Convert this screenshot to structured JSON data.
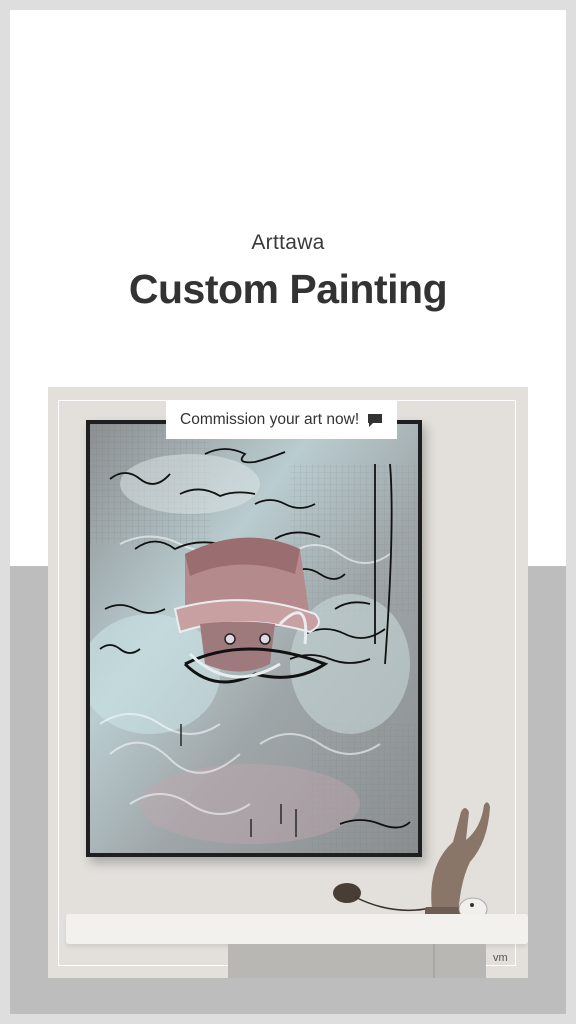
{
  "brand": "Arttawa",
  "title": "Custom Painting",
  "badge": {
    "label": "Commission your art now!",
    "icon": "chat-bubble-icon"
  },
  "watermark": "vm",
  "colors": {
    "background_top": "#ffffff",
    "background_bottom": "#bdbdbd",
    "border": "#dedede",
    "wall": "#e3e0dc",
    "text": "#333333"
  }
}
